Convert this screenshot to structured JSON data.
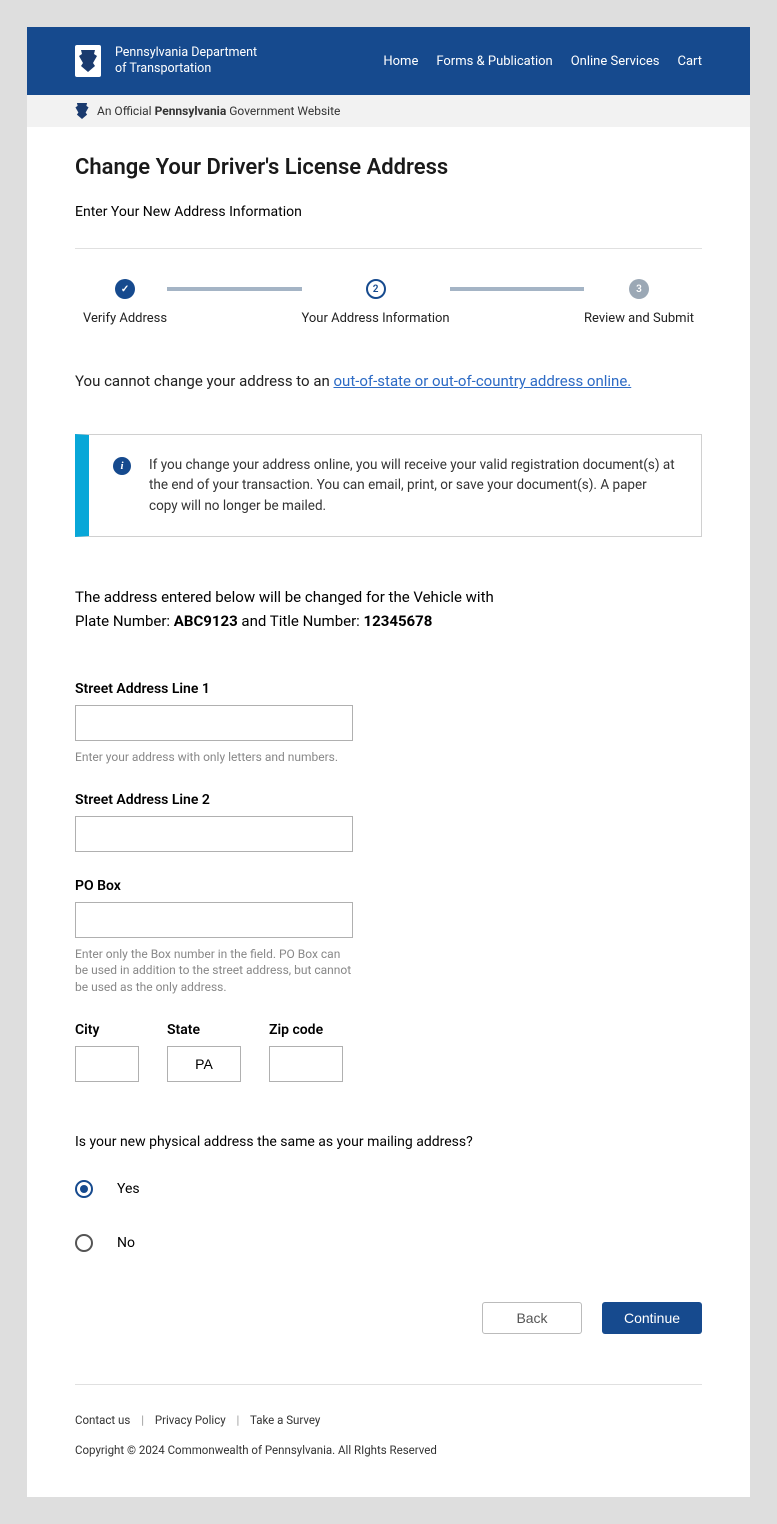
{
  "header": {
    "dept_line1": "Pennsylvania Department",
    "dept_line2": "of Transportation",
    "nav": {
      "home": "Home",
      "forms": "Forms & Publication",
      "services": "Online Services",
      "cart": "Cart"
    }
  },
  "gov_bar": {
    "prefix": "An Official ",
    "state": "Pennsylvania",
    "suffix": " Government Website"
  },
  "page": {
    "title": "Change Your Driver's License Address",
    "subtitle": "Enter Your New Address Information"
  },
  "stepper": {
    "step1": "Verify Address",
    "step2": "Your Address Information",
    "step2_num": "2",
    "step3": "Review and Submit",
    "step3_num": "3"
  },
  "warn": {
    "prefix": "You cannot change your address to an ",
    "link": "out-of-state or out-of-country address online."
  },
  "info": {
    "text": "If you change your address online, you will receive your valid registration document(s) at the end of your transaction. You can email, print, or save your document(s). A paper copy will no longer be mailed."
  },
  "context": {
    "line1": "The address entered below will be changed for the Vehicle with",
    "plate_label": "Plate Number: ",
    "plate_value": "ABC9123",
    "title_label": " and Title Number: ",
    "title_value": "12345678"
  },
  "form": {
    "street1": {
      "label": "Street Address Line 1",
      "help": "Enter your address with only letters and numbers."
    },
    "street2": {
      "label": "Street Address Line 2"
    },
    "pobox": {
      "label": "PO Box",
      "help": "Enter only the Box number in the field. PO Box can be used in addition to the street address, but cannot be used as the only address."
    },
    "city": {
      "label": "City"
    },
    "state": {
      "label": "State",
      "value": "PA"
    },
    "zip": {
      "label": "Zip code"
    }
  },
  "question_text": "Is your new physical address the same as your mailing address?",
  "radio": {
    "yes": "Yes",
    "no": "No"
  },
  "buttons": {
    "back": "Back",
    "continue": "Continue"
  },
  "footer": {
    "contact": "Contact us",
    "privacy": "Privacy Policy",
    "survey": "Take a Survey",
    "copyright": "Copyright © 2024 Commonwealth of Pennsylvania. All RIghts Reserved"
  }
}
